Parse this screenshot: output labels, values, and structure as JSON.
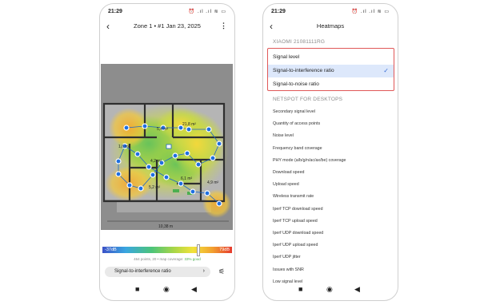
{
  "left_phone": {
    "status": {
      "time": "21:29",
      "icons": "⏰ .ıl .ıl ≋ ▭"
    },
    "title": "Zone 1 • #1 Jan 23, 2025",
    "map_labels": {
      "room_a": "5,4 m²",
      "room_b": "21,8 m²",
      "room_c": "1,6 m²",
      "room_d": "4,2 m²",
      "room_e": "6,1 m²",
      "room_f": "5,2 m²",
      "room_g": "4,9 m²",
      "dimension": "10,38 m"
    },
    "legend": {
      "min": "-37dB",
      "max": "79dB"
    },
    "stats": {
      "text": "464 points, 20 • map coverage:",
      "good": "33% good"
    },
    "selector": {
      "label": "Signal-to-interference ratio",
      "chevron": "›"
    },
    "icons": {
      "back": "‹",
      "menu": "⋮",
      "filter": "⚟"
    }
  },
  "right_phone": {
    "status": {
      "time": "21:29",
      "icons": "⏰ .ıl .ıl ≋ ▭"
    },
    "title": "Heatmaps",
    "device_section": "XIAOMI 21081111RG",
    "options": [
      {
        "label": "Signal level",
        "selected": false
      },
      {
        "label": "Signal-to-interference ratio",
        "selected": true
      },
      {
        "label": "Signal-to-noise ratio",
        "selected": false
      }
    ],
    "desktop_section": "NETSPOT FOR DESKTOPS",
    "desktop_items": [
      "Secondary signal level",
      "Quantity of access points",
      "Noise level",
      "Frequency band coverage",
      "PHY mode (a/b/g/n/ac/ax/be) coverage",
      "Download speed",
      "Upload speed",
      "Wireless transmit rate",
      "Iperf TCP download speed",
      "Iperf TCP upload speed",
      "Iperf UDP download speed",
      "Iperf UDP upload speed",
      "Iperf UDP jitter",
      "Issues with SNR",
      "Low signal level"
    ],
    "check_icon": "✓"
  },
  "nav": {
    "square": "■",
    "home": "◉",
    "back": "◀"
  },
  "colors": {
    "accent": "#3b6fd6",
    "highlight_border": "#e05858",
    "selected_bg": "#dde8fb"
  }
}
